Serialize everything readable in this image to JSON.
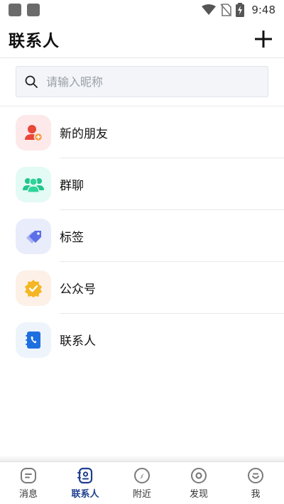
{
  "status_bar": {
    "time": "9:48",
    "icons": [
      "notification-icon",
      "notification-icon",
      "wifi-icon",
      "no-sim-icon",
      "battery-charging-icon"
    ]
  },
  "header": {
    "title": "联系人",
    "add_icon": "plus-icon"
  },
  "search": {
    "placeholder": "请输入昵称",
    "value": "",
    "icon": "search-icon"
  },
  "contacts_menu": [
    {
      "label": "新的朋友",
      "icon": "new-friend-icon",
      "color": "#e8473a",
      "bg": "#fde8ea"
    },
    {
      "label": "群聊",
      "icon": "group-chat-icon",
      "color": "#22c58b",
      "bg": "#e3faf5"
    },
    {
      "label": "标签",
      "icon": "tag-icon",
      "color": "#5b6fe8",
      "bg": "#e8ecfb"
    },
    {
      "label": "公众号",
      "icon": "official-account-icon",
      "color": "#f5b623",
      "bg": "#fdf0e6"
    },
    {
      "label": "联系人",
      "icon": "contact-book-icon",
      "color": "#1e6fe0",
      "bg": "#eef4fb"
    }
  ],
  "tabbar": {
    "active_color": "#1f3f8f",
    "items": [
      {
        "label": "消息",
        "icon": "message-icon",
        "active": false
      },
      {
        "label": "联系人",
        "icon": "contacts-icon",
        "active": true
      },
      {
        "label": "附近",
        "icon": "nearby-compass-icon",
        "active": false
      },
      {
        "label": "发现",
        "icon": "discover-icon",
        "active": false
      },
      {
        "label": "我",
        "icon": "me-icon",
        "active": false
      }
    ]
  }
}
